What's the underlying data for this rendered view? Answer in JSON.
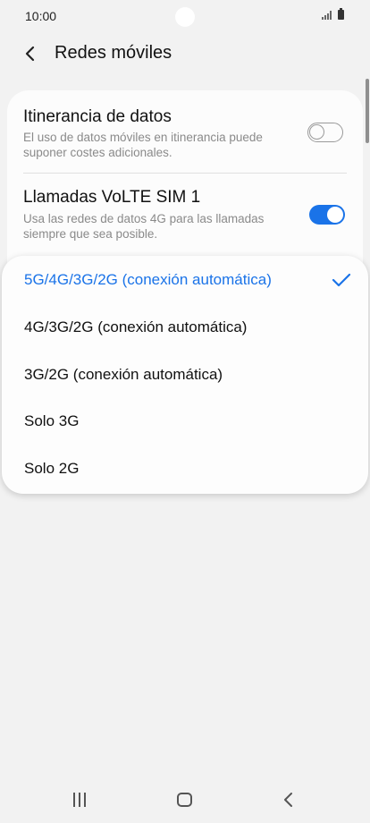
{
  "status_bar": {
    "time": "10:00",
    "signal_icon": "signal-icon",
    "battery_icon": "battery-icon"
  },
  "header": {
    "back_icon": "chevron-left-icon",
    "title": "Redes móviles"
  },
  "settings": {
    "roaming": {
      "title": "Itinerancia de datos",
      "description": "El uso de datos móviles en itinerancia puede suponer costes adicionales.",
      "enabled": false
    },
    "volte": {
      "title": "Llamadas VoLTE SIM 1",
      "description": "Usa las redes de datos 4G para las llamadas siempre que sea posible.",
      "enabled": true
    }
  },
  "network_mode_dropdown": {
    "options": [
      {
        "label": "5G/4G/3G/2G (conexión automática)",
        "selected": true
      },
      {
        "label": "4G/3G/2G (conexión automática)",
        "selected": false
      },
      {
        "label": "3G/2G (conexión automática)",
        "selected": false
      },
      {
        "label": "Solo 3G",
        "selected": false
      },
      {
        "label": "Solo 2G",
        "selected": false
      }
    ]
  },
  "nav_bar": {
    "recent_icon": "recent-apps-icon",
    "home_icon": "home-icon",
    "back_icon": "back-icon"
  },
  "colors": {
    "accent": "#1a73e8",
    "background": "#f2f2f2",
    "card": "#fcfcfc",
    "secondary_text": "#8a8a8a"
  }
}
